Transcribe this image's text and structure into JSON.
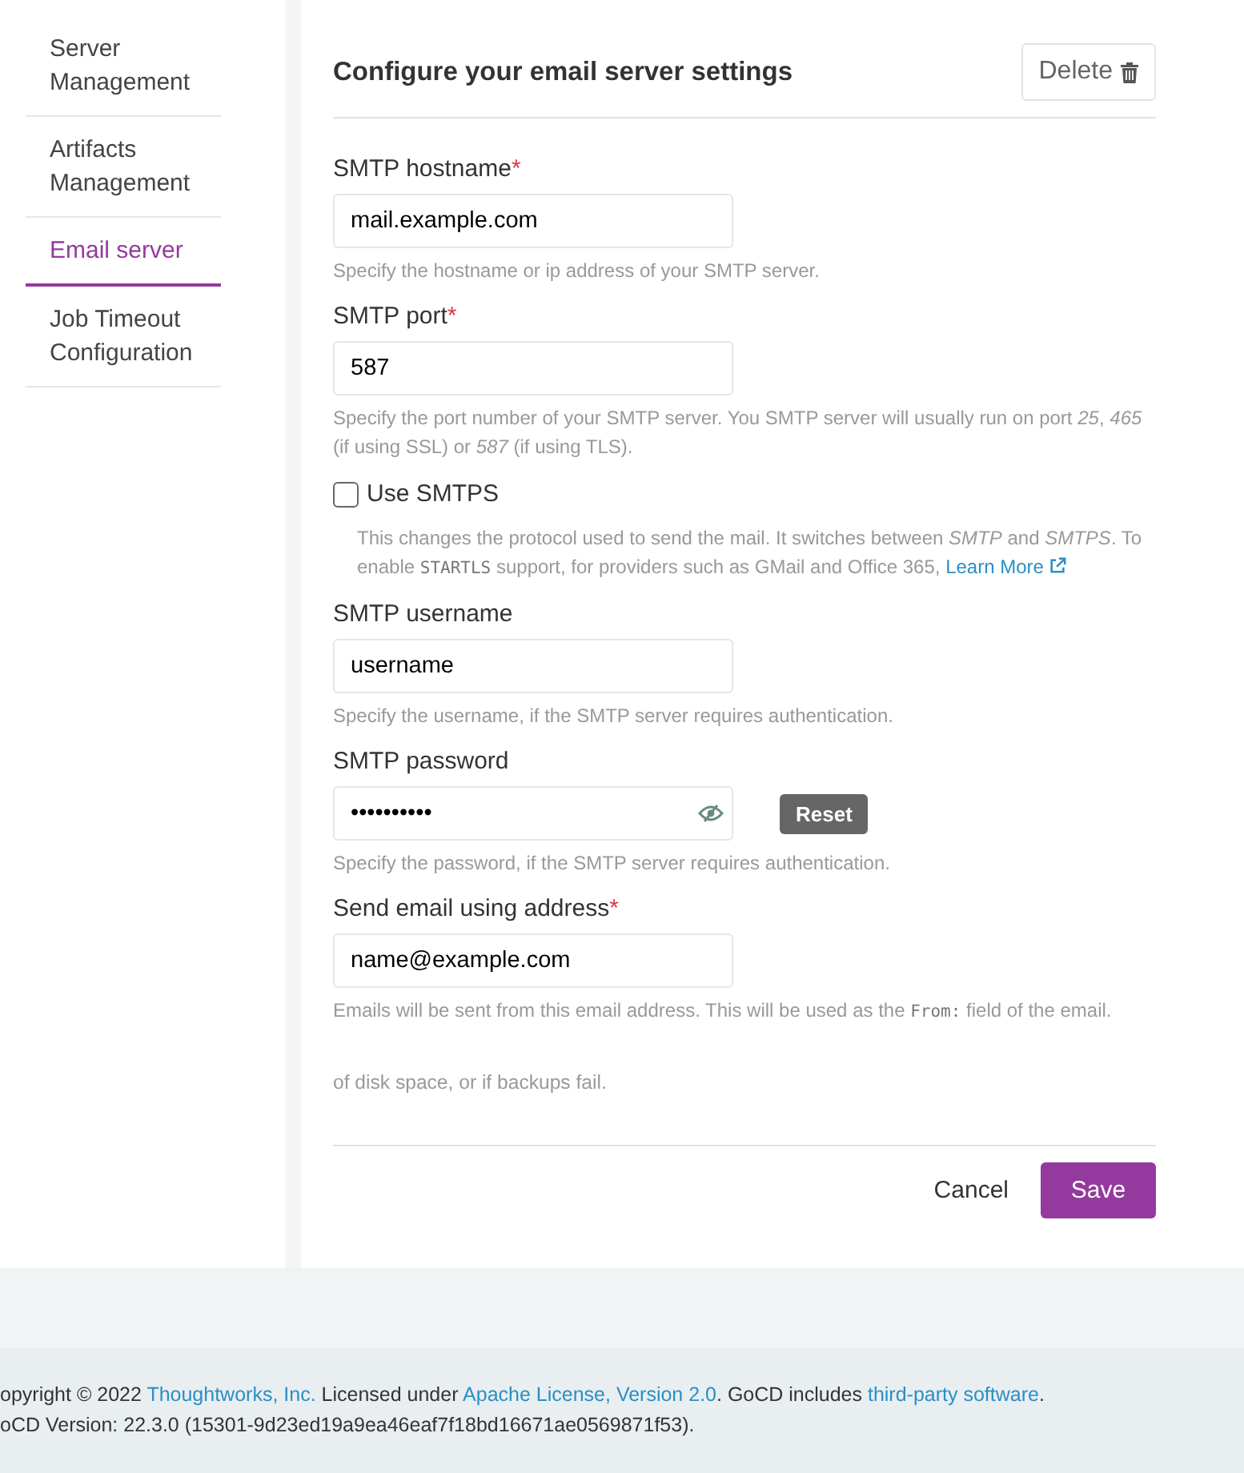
{
  "sidebar": {
    "items": [
      {
        "label": "Server Management",
        "selected": false
      },
      {
        "label": "Artifacts Management",
        "selected": false
      },
      {
        "label": "Email server",
        "selected": true
      },
      {
        "label": "Job Timeout Configuration",
        "selected": false
      }
    ]
  },
  "form": {
    "title": "Configure your email server settings",
    "delete_button": "Delete",
    "fields": [
      {
        "kind": "text",
        "label": "SMTP hostname",
        "required_mark": "*",
        "value": "mail.example.com",
        "help": [
          {
            "kind": "text",
            "text": "Specify the hostname or ip address of your SMTP server."
          }
        ]
      },
      {
        "kind": "text",
        "label": "SMTP port",
        "required_mark": "*",
        "value": "587",
        "help": [
          {
            "kind": "text",
            "text": "Specify the port number of your SMTP server. You SMTP server will usually run on port *25*, *465* (if using SSL) or *587* (if using TLS)."
          }
        ]
      },
      {
        "kind": "checkbox",
        "label": "Use SMTPS",
        "checked": false,
        "help": [
          {
            "kind": "text",
            "text": "This changes the protocol used to send the mail. It switches between *SMTP* and *SMTPS*. To enable "
          },
          {
            "kind": "code",
            "text": "STARTLS"
          },
          {
            "kind": "text",
            "text": " support, for providers such as GMail and Office 365, "
          },
          {
            "kind": "link",
            "text": "Learn More",
            "external": true
          }
        ]
      },
      {
        "kind": "text",
        "label": "SMTP username",
        "value": "username",
        "help": [
          {
            "kind": "text",
            "text": "Specify the username, if the SMTP server requires authentication."
          }
        ]
      },
      {
        "kind": "password",
        "label": "SMTP password",
        "value": "••••••••••",
        "reset_button": "Reset",
        "help": [
          {
            "kind": "text",
            "text": "Specify the password, if the SMTP server requires authentication."
          }
        ]
      },
      {
        "kind": "text",
        "label": "Send email using address",
        "required_mark": "*",
        "value": "name@example.com",
        "help": [
          {
            "kind": "text",
            "text": "Emails will be sent from this email address. This will be used as the "
          },
          {
            "kind": "code",
            "text": "From:"
          },
          {
            "kind": "text",
            "text": " field of the email."
          }
        ]
      }
    ],
    "clipped_note": "of disk space, or if backups fail.",
    "cancel_button": "Cancel",
    "save_button": "Save"
  },
  "footer": {
    "lines": [
      [
        {
          "kind": "text",
          "text": "opyright © 2022 "
        },
        {
          "kind": "link",
          "text": "Thoughtworks, Inc."
        },
        {
          "kind": "text",
          "text": " Licensed under "
        },
        {
          "kind": "link",
          "text": "Apache License, Version 2.0"
        },
        {
          "kind": "text",
          "text": ". GoCD includes "
        },
        {
          "kind": "link",
          "text": "third-party software"
        },
        {
          "kind": "text",
          "text": "."
        }
      ],
      [
        {
          "kind": "text",
          "text": "oCD Version: 22.3.0 (15301-9d23ed19a9ea46eaf7f18bd16671ae0569871f53)."
        }
      ]
    ]
  }
}
